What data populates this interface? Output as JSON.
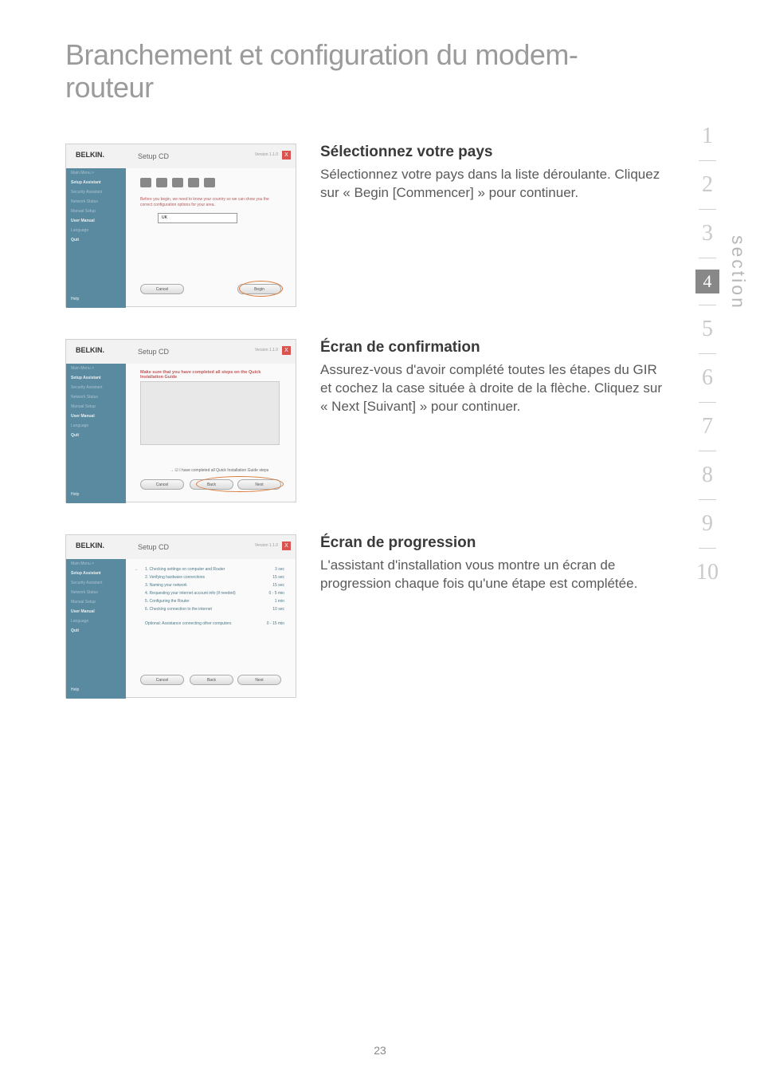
{
  "page": {
    "title_line1": "Branchement et configuration du modem-",
    "title_line2": "routeur",
    "number": "23"
  },
  "screenshot_common": {
    "brand": "BELKIN.",
    "header": "Setup CD",
    "version": "Version 1.1.0",
    "close": "X",
    "help": "Help"
  },
  "sidebar": {
    "main_menu": "Main Menu >",
    "setup_assistant": "Setup Assistant",
    "security_assistant": "Security Assistant",
    "network_status": "Network Status",
    "manual_setup": "Manual Setup",
    "user_manual": "User Manual",
    "language": "Language",
    "quit": "Quit"
  },
  "shot1": {
    "instruction": "Before you begin, we need to know your country so we can show you the correct configuration options for your area.",
    "dropdown": "UK",
    "cancel": "Cancel",
    "begin": "Begin"
  },
  "shot2": {
    "instruction": "Make sure that you have completed all steps on the Quick Installation Guide",
    "checkbox_label": "I have completed all Quick Installation Guide steps",
    "cancel": "Cancel",
    "back": "Back",
    "next": "Next"
  },
  "shot3": {
    "items": [
      {
        "label": "1. Checking settings on computer and Router",
        "time": "3 sec"
      },
      {
        "label": "2. Verifying hardware connections",
        "time": "15 sec"
      },
      {
        "label": "3. Naming your network",
        "time": "15 sec"
      },
      {
        "label": "4. Requesting your internet account info (if needed)",
        "time": "0 - 5 min"
      },
      {
        "label": "5. Configuring the Router",
        "time": "1 min"
      },
      {
        "label": "6. Checking connection to the internet",
        "time": "10 sec"
      }
    ],
    "optional": "Optional: Assistance connecting other computers",
    "optional_time": "0 - 15 min",
    "cancel": "Cancel",
    "back": "Back",
    "next": "Next"
  },
  "text1": {
    "heading": "Sélectionnez votre pays",
    "body": "Sélectionnez votre pays dans la liste déroulante. Cliquez sur « Begin [Commencer] » pour continuer."
  },
  "text2": {
    "heading": "Écran de confirmation",
    "body": "Assurez-vous d'avoir complété toutes les étapes du GIR et cochez la case située à droite de la flèche. Cliquez sur « Next [Suivant] » pour continuer."
  },
  "text3": {
    "heading": "Écran de progression",
    "body": "L'assistant d'installation vous montre un écran de progression chaque fois qu'une étape est complétée."
  },
  "nav": {
    "n1": "1",
    "n2": "2",
    "n3": "3",
    "n4": "4",
    "n5": "5",
    "n6": "6",
    "n7": "7",
    "n8": "8",
    "n9": "9",
    "n10": "10",
    "label": "section"
  }
}
